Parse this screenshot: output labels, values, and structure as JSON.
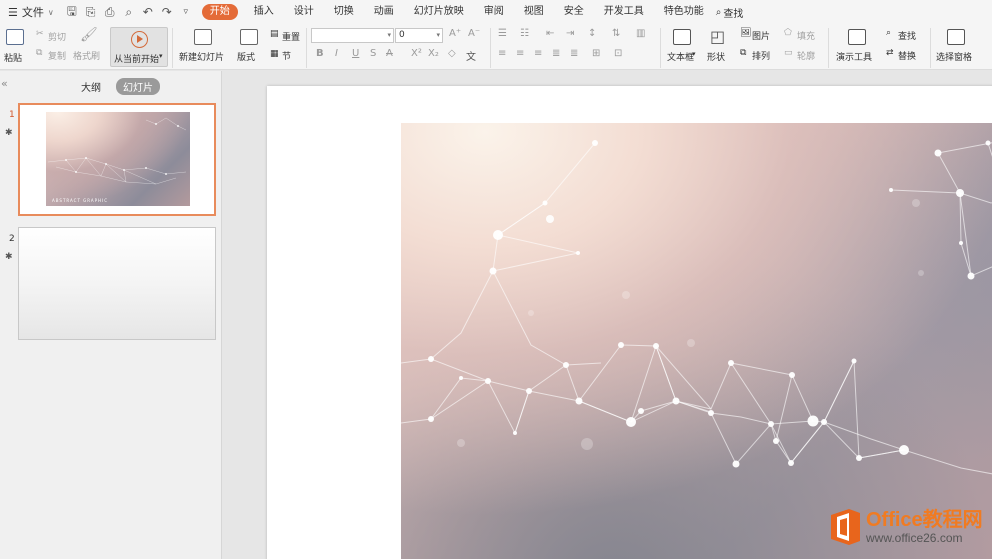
{
  "menubar": {
    "file_label": "文件",
    "tabs": [
      "开始",
      "插入",
      "设计",
      "切换",
      "动画",
      "幻灯片放映",
      "审阅",
      "视图",
      "安全",
      "开发工具",
      "特色功能"
    ],
    "active_tab": "开始",
    "search_label": "查找"
  },
  "ribbon": {
    "paste": "粘贴",
    "cut": "剪切",
    "copy": "复制",
    "format_painter": "格式刷",
    "from_current": "从当前开始",
    "new_slide": "新建幻灯片",
    "layout": "版式",
    "reset": "重置",
    "section": "节",
    "font_size": "0",
    "text_box": "文本框",
    "shape": "形状",
    "picture": "图片",
    "fill": "填充",
    "arrange": "排列",
    "outline": "轮廓",
    "presentation_tools": "演示工具",
    "find": "查找",
    "replace": "替换",
    "selection_pane": "选择窗格"
  },
  "left_panel": {
    "outline_tab": "大纲",
    "slides_tab": "幻灯片",
    "slides": [
      {
        "number": "1",
        "active": true
      },
      {
        "number": "2",
        "active": false
      }
    ],
    "thumb1_caption": "ABSTRACT GRAPHIC"
  },
  "watermark": {
    "title": "Office教程网",
    "url": "www.office26.com"
  },
  "colors": {
    "accent": "#e46b38",
    "selection_border": "#e88b5c",
    "watermark_orange": "#f07b22"
  }
}
